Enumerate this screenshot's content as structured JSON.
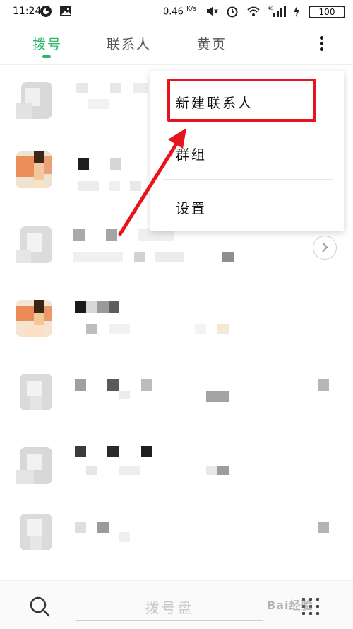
{
  "status_bar": {
    "time": "11:24",
    "net_speed": "0.46",
    "net_speed_unit": "K/s",
    "signal_type": "4G",
    "battery": "100"
  },
  "tabs": [
    {
      "label": "拨号",
      "active": true
    },
    {
      "label": "联系人",
      "active": false
    },
    {
      "label": "黄页",
      "active": false
    }
  ],
  "menu": {
    "items": [
      {
        "label": "新建联系人",
        "highlighted": true
      },
      {
        "label": "群组",
        "highlighted": false
      },
      {
        "label": "设置",
        "highlighted": false
      }
    ]
  },
  "bottom_bar": {
    "dialpad_label": "拨号盘",
    "search_icon": "search-icon",
    "dialpad_icon": "keypad-grid-icon"
  },
  "watermark": "Bai经验",
  "colors": {
    "accent": "#2db86d",
    "highlight_box": "#e8141d",
    "annotation_arrow": "#e8141d"
  }
}
